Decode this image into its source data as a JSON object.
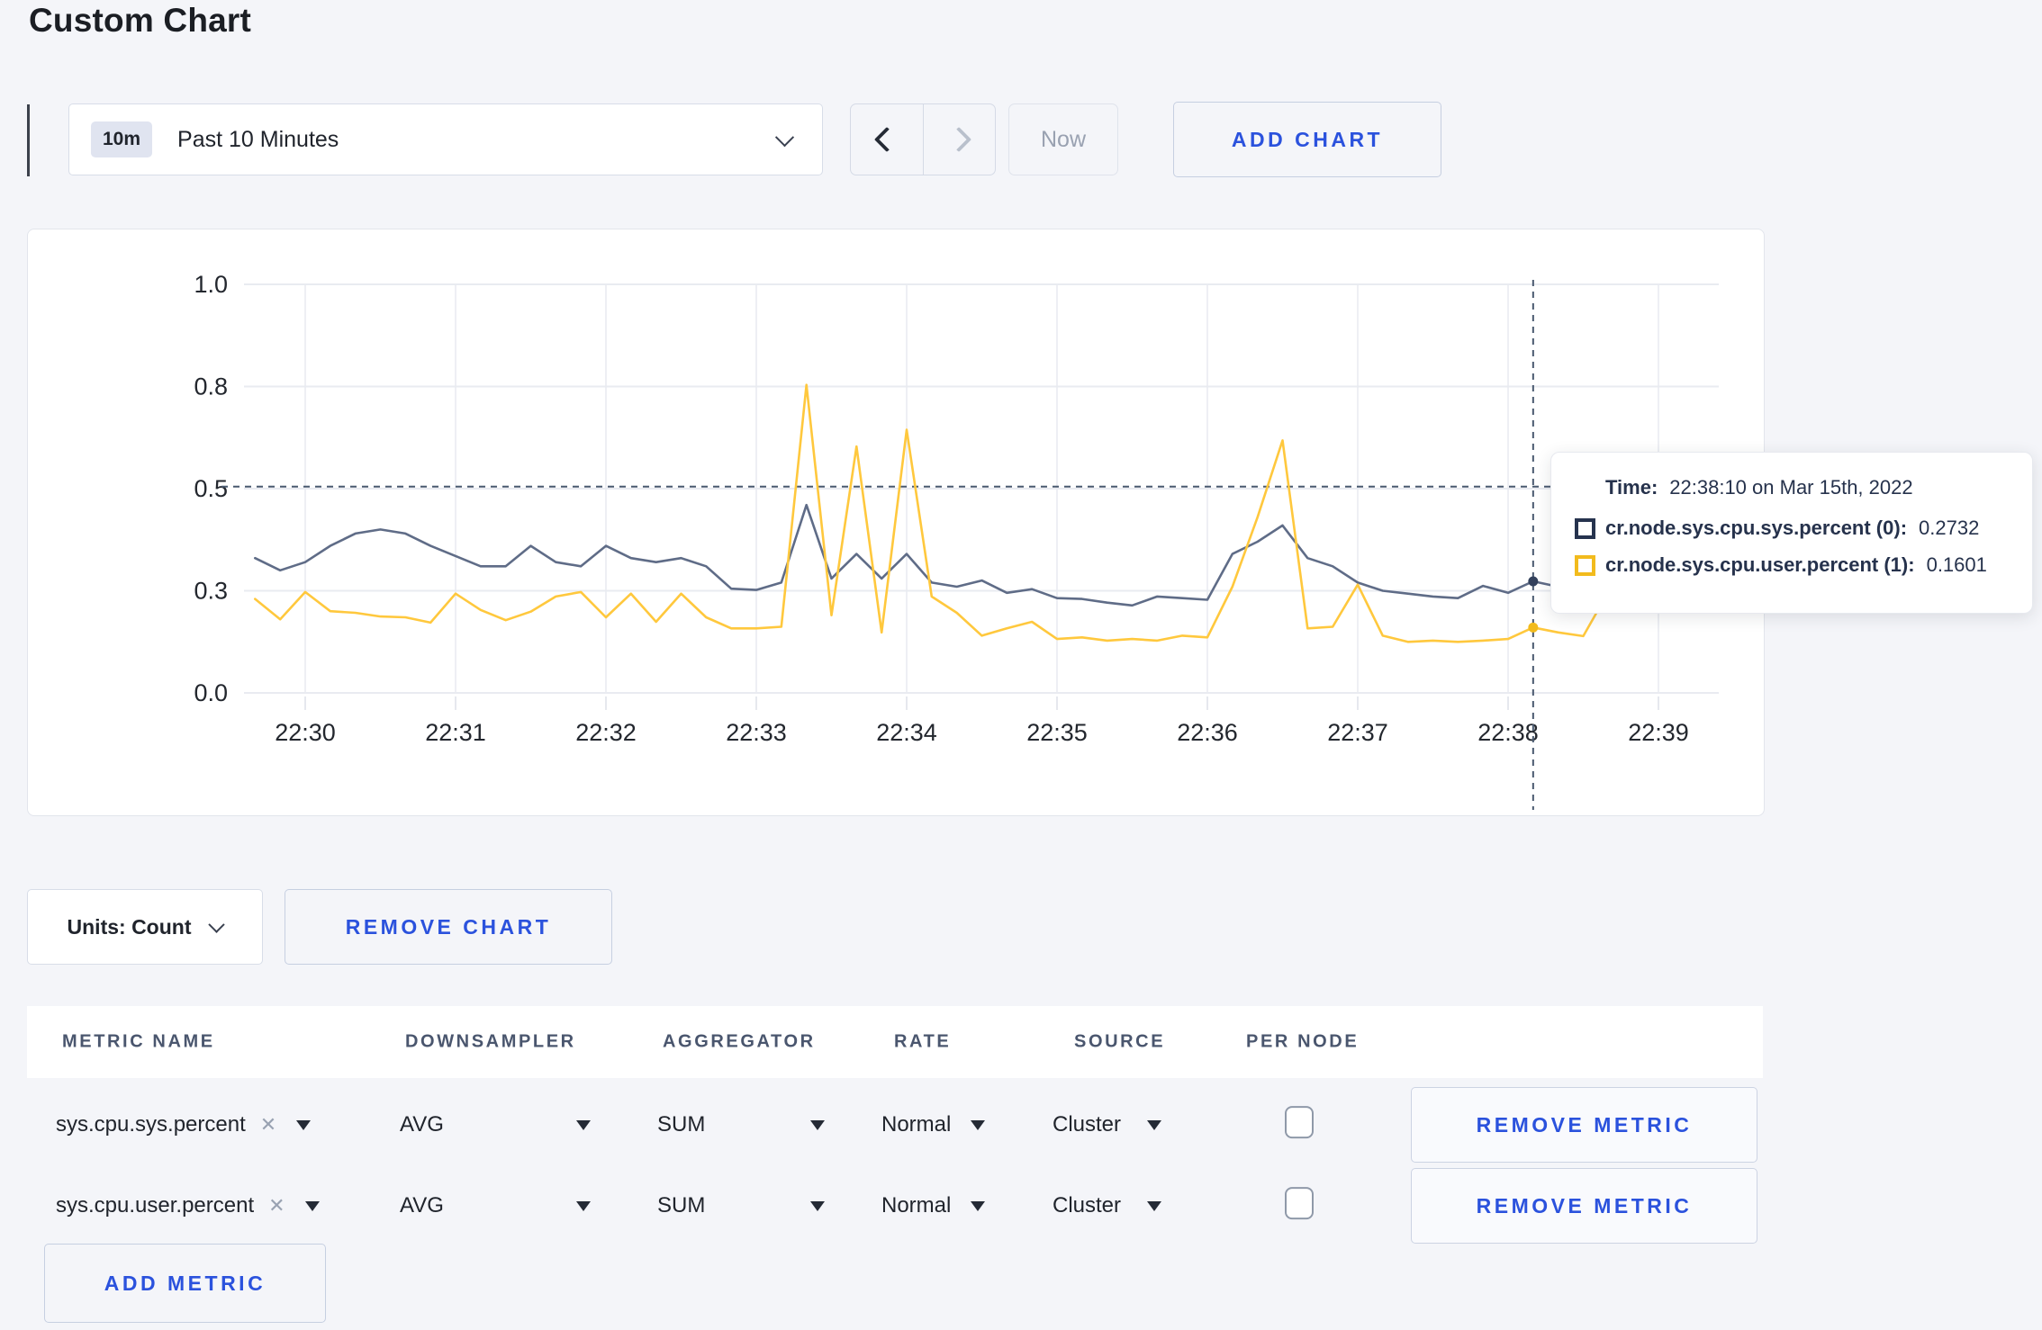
{
  "page": {
    "title": "Custom Chart",
    "background": "#f4f5f9",
    "accent_blue": "#2b52dd"
  },
  "toolbar": {
    "time_range": {
      "badge": "10m",
      "label": "Past 10 Minutes"
    },
    "now_label": "Now",
    "add_chart_label": "ADD CHART"
  },
  "chart_data": {
    "type": "line",
    "title": "",
    "xlabel": "",
    "ylabel": "",
    "x_start_sec": -20,
    "x_step_sec": 10,
    "x_axis": {
      "tick_labels": [
        "22:30",
        "22:31",
        "22:32",
        "22:33",
        "22:34",
        "22:35",
        "22:36",
        "22:37",
        "22:38",
        "22:39"
      ],
      "tick_interval_sec": 60
    },
    "y_axis": {
      "tick_values": [
        0,
        0.25,
        0.5,
        0.75,
        1.0
      ],
      "tick_labels": [
        "0.0",
        "0.3",
        "0.5",
        "0.8",
        "1.0"
      ],
      "range": [
        0,
        1
      ]
    },
    "grid": true,
    "legend_position": "tooltip",
    "series": [
      {
        "name": "cr.node.sys.cpu.sys.percent",
        "color": "#5f6c87",
        "swatch": "#26334e",
        "values": [
          0.33,
          0.3,
          0.32,
          0.36,
          0.39,
          0.4,
          0.39,
          0.36,
          0.335,
          0.31,
          0.31,
          0.36,
          0.32,
          0.31,
          0.36,
          0.33,
          0.32,
          0.33,
          0.31,
          0.255,
          0.252,
          0.27,
          0.46,
          0.28,
          0.34,
          0.28,
          0.34,
          0.27,
          0.26,
          0.275,
          0.245,
          0.254,
          0.232,
          0.23,
          0.221,
          0.214,
          0.236,
          0.232,
          0.228,
          0.34,
          0.37,
          0.41,
          0.33,
          0.31,
          0.27,
          0.25,
          0.243,
          0.236,
          0.232,
          0.262,
          0.245,
          0.2732,
          0.26,
          0.265,
          0.27,
          0.268,
          0.272,
          0.27
        ]
      },
      {
        "name": "cr.node.sys.cpu.user.percent",
        "color": "#ffc83d",
        "swatch": "#f2bb1d",
        "values": [
          0.23,
          0.18,
          0.247,
          0.2,
          0.196,
          0.187,
          0.185,
          0.172,
          0.243,
          0.203,
          0.178,
          0.199,
          0.236,
          0.247,
          0.185,
          0.243,
          0.174,
          0.243,
          0.185,
          0.158,
          0.158,
          0.162,
          0.754,
          0.19,
          0.603,
          0.148,
          0.644,
          0.236,
          0.196,
          0.14,
          0.158,
          0.174,
          0.132,
          0.136,
          0.128,
          0.132,
          0.128,
          0.14,
          0.136,
          0.26,
          0.43,
          0.618,
          0.158,
          0.162,
          0.265,
          0.14,
          0.125,
          0.128,
          0.125,
          0.128,
          0.132,
          0.1601,
          0.148,
          0.139,
          0.247,
          0.295,
          0.211,
          0.214
        ]
      }
    ],
    "crosshair": {
      "time_sec": 490,
      "y_value": 0.505
    }
  },
  "tooltip": {
    "time_label": "Time:",
    "time_value": "22:38:10 on Mar 15th, 2022",
    "entries": [
      {
        "label": "cr.node.sys.cpu.sys.percent (0):",
        "value": "0.2732"
      },
      {
        "label": "cr.node.sys.cpu.user.percent (1):",
        "value": "0.1601"
      }
    ]
  },
  "units": {
    "label": "Units: Count",
    "remove_chart_label": "REMOVE CHART"
  },
  "metrics": {
    "headers": [
      "METRIC NAME",
      "DOWNSAMPLER",
      "AGGREGATOR",
      "RATE",
      "SOURCE",
      "PER NODE"
    ],
    "rows": [
      {
        "name": "sys.cpu.sys.percent",
        "downsampler": "AVG",
        "aggregator": "SUM",
        "rate": "Normal",
        "source": "Cluster",
        "per_node_checked": false,
        "remove_label": "REMOVE METRIC"
      },
      {
        "name": "sys.cpu.user.percent",
        "downsampler": "AVG",
        "aggregator": "SUM",
        "rate": "Normal",
        "source": "Cluster",
        "per_node_checked": false,
        "remove_label": "REMOVE METRIC"
      }
    ],
    "add_metric_label": "ADD METRIC"
  }
}
